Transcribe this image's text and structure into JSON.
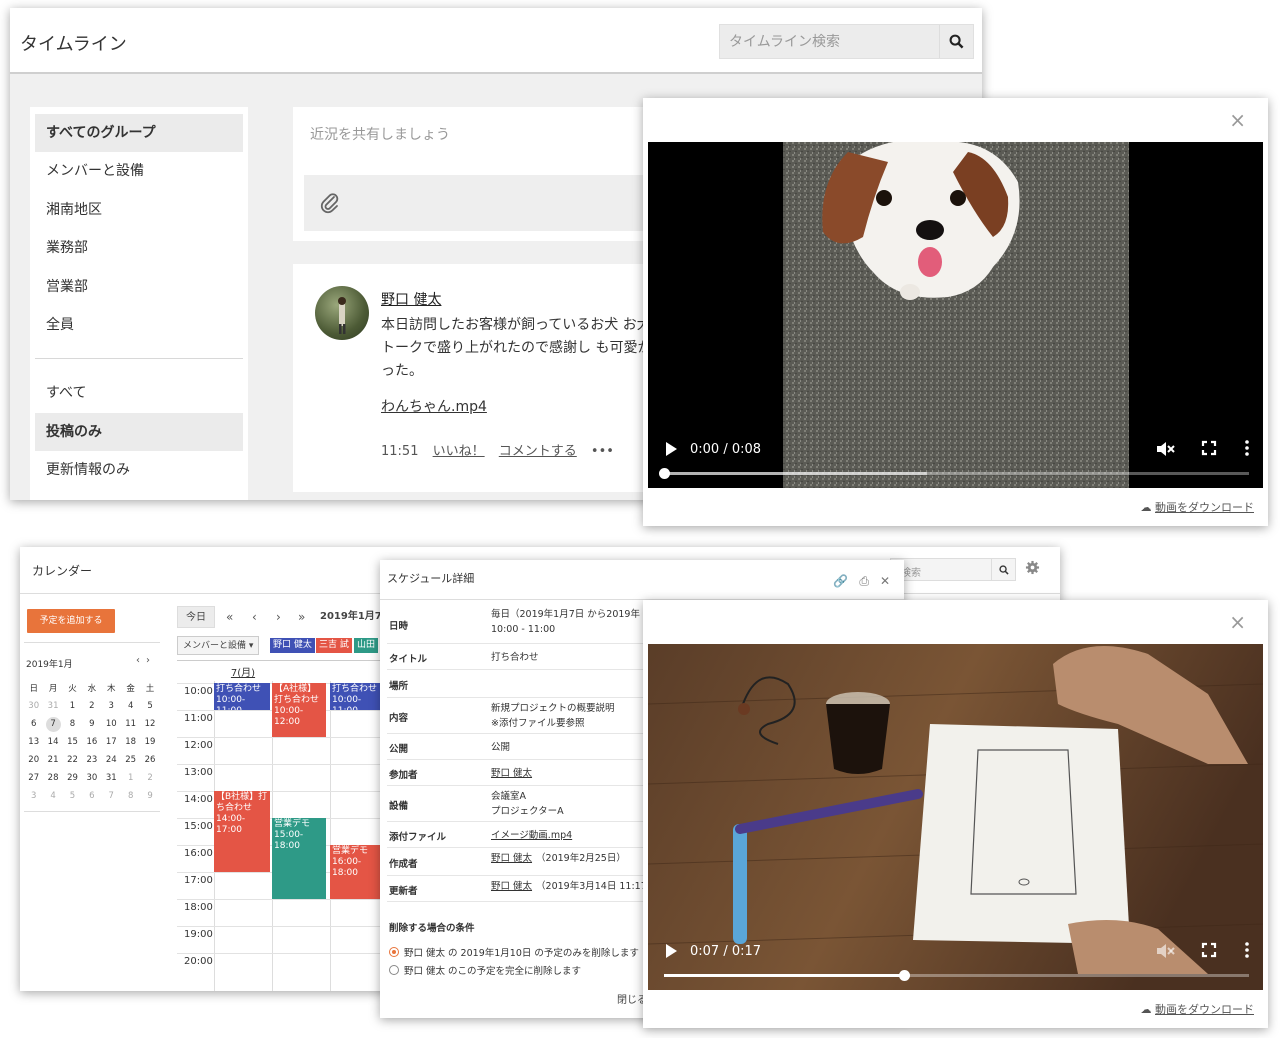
{
  "timeline": {
    "title": "タイムライン",
    "search_placeholder": "タイムライン検索",
    "groups": [
      "すべてのグループ",
      "メンバーと設備",
      "湘南地区",
      "業務部",
      "営業部",
      "全員"
    ],
    "filters": [
      "すべて",
      "投稿のみ",
      "更新情報のみ"
    ],
    "composer_placeholder": "近況を共有しましょう",
    "post": {
      "author": "野口 健太",
      "body": "本日訪問したお客様が飼っているお犬 お犬トークで盛り上がれたので感謝し も可愛かった。",
      "attachment": "わんちゃん.mp4",
      "time": "11:51",
      "like": "いいね！",
      "comment": "コメントする",
      "more": "•••"
    }
  },
  "video1": {
    "time": "0:00 / 0:08",
    "progress": 0.0,
    "buffered": 0.45,
    "download": "動画をダウンロード",
    "close": "×"
  },
  "video2": {
    "time": "0:07 / 0:17",
    "progress": 0.41,
    "buffered": 0.41,
    "download": "動画をダウンロード",
    "close": "×"
  },
  "calendar": {
    "title": "カレンダー",
    "search_placeholder": "検索",
    "add_button": "予定を追加する",
    "mini_title": "2019年1月",
    "mini_nav": [
      "‹",
      "›"
    ],
    "weekdays": [
      "日",
      "月",
      "火",
      "水",
      "木",
      "金",
      "土"
    ],
    "weeks": [
      [
        "30",
        "31",
        "1",
        "2",
        "3",
        "4",
        "5"
      ],
      [
        "6",
        "7",
        "8",
        "9",
        "10",
        "11",
        "12"
      ],
      [
        "13",
        "14",
        "15",
        "16",
        "17",
        "18",
        "19"
      ],
      [
        "20",
        "21",
        "22",
        "23",
        "24",
        "25",
        "26"
      ],
      [
        "27",
        "28",
        "29",
        "30",
        "31",
        "1",
        "2"
      ],
      [
        "3",
        "4",
        "5",
        "6",
        "7",
        "8",
        "9"
      ]
    ],
    "today_button": "今日",
    "nav": [
      "«",
      "‹",
      "›",
      "»"
    ],
    "range_label": "2019年1月7日",
    "group_select": "メンバーと設備",
    "member_chips": [
      {
        "label": "野口 健太",
        "color": "#3f51b5"
      },
      {
        "label": "三吉 試",
        "color": "#e45545"
      },
      {
        "label": "山田",
        "color": "#2e9a87"
      }
    ],
    "day_header": "7(月)",
    "hours": [
      "10:00",
      "11:00",
      "12:00",
      "13:00",
      "14:00",
      "15:00",
      "16:00",
      "17:00",
      "18:00",
      "19:00",
      "20:00"
    ],
    "events": [
      {
        "title": "打ち合わせ",
        "time": "10:00-11:00",
        "color": "#3f51b5"
      },
      {
        "title": "【A社様】打ち合わせ",
        "time": "10:00-12:00",
        "color": "#e45545"
      },
      {
        "title": "打ち合わせ",
        "time": "10:00-11:00",
        "color": "#3f51b5"
      },
      {
        "title": "【B社様】打ち合わせ",
        "time": "14:00-17:00",
        "color": "#e45545"
      },
      {
        "title": "営業デモ",
        "time": "15:00-18:00",
        "color": "#2e9a87"
      },
      {
        "title": "営業デモ",
        "time": "16:00-18:00",
        "color": "#e45545"
      }
    ]
  },
  "schedule": {
    "title": "スケジュール詳細",
    "rows": [
      {
        "label": "日時",
        "value": "毎日（2019年1月7日 から2019年",
        "value2": "10:00 - 11:00"
      },
      {
        "label": "タイトル",
        "value": "打ち合わせ"
      },
      {
        "label": "場所",
        "value": ""
      },
      {
        "label": "内容",
        "value": "新規プロジェクトの概要説明",
        "value2": "※添付ファイル要参照"
      },
      {
        "label": "公開",
        "value": "公開"
      },
      {
        "label": "参加者",
        "value": "野口 健太"
      },
      {
        "label": "設備",
        "value": "会議室A",
        "value2": "プロジェクターA"
      },
      {
        "label": "添付ファイル",
        "value": "イメージ動画.mp4"
      },
      {
        "label": "作成者",
        "value": "野口 健太",
        "value2": "（2019年2月25日）"
      },
      {
        "label": "更新者",
        "value": "野口 健太",
        "value2": "（2019年3月14日 11:17）"
      }
    ],
    "delete_condition": "削除する場合の条件",
    "options": [
      "野口 健太 の 2019年1月10日 の予定のみを削除します",
      "野口 健太 のこの予定を完全に削除します"
    ],
    "close": "閉じる"
  }
}
